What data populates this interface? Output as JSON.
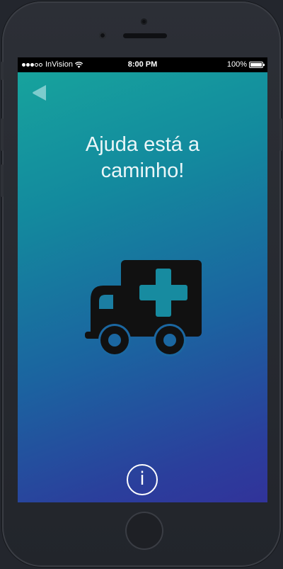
{
  "status_bar": {
    "signal_bars_full": 3,
    "signal_bars_total": 5,
    "carrier": "InVision",
    "wifi_icon": "wifi-icon",
    "time": "8:00 PM",
    "battery_percent": "100%",
    "battery_level": 1.0
  },
  "header": {
    "back_icon": "back-arrow-icon"
  },
  "main": {
    "title_line1": "Ajuda está a",
    "title_line2": "caminho!",
    "illustration_icon": "ambulance-icon"
  },
  "footer": {
    "info_label": "i",
    "info_icon": "info-icon"
  },
  "colors": {
    "gradient_top": "#17a39d",
    "gradient_bottom": "#31339a",
    "icon_fill": "#111111",
    "text": "#eaf6f8"
  }
}
